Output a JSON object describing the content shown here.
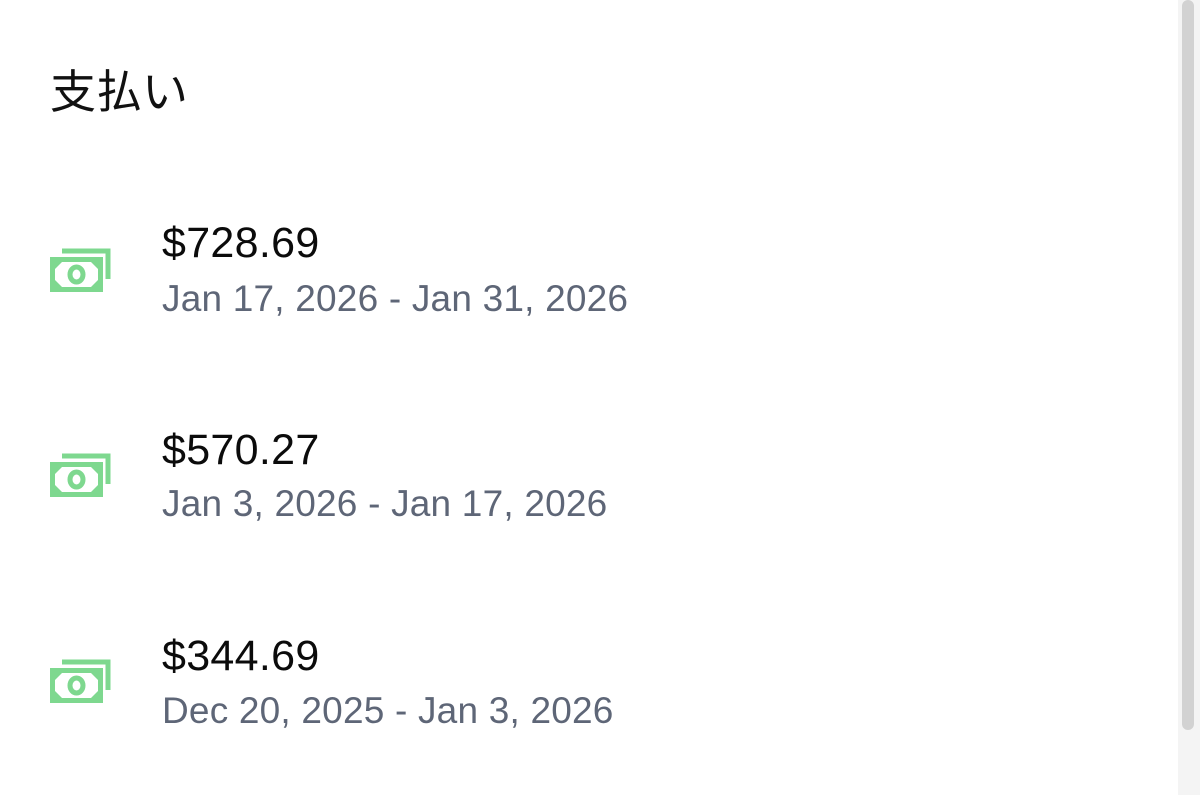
{
  "header": {
    "title": "支払い"
  },
  "accent_color": "#7ed88f",
  "payouts": [
    {
      "amount": "$728.69",
      "period": "Jan 17, 2026 - Jan 31, 2026",
      "icon": "cash-icon"
    },
    {
      "amount": "$570.27",
      "period": "Jan 3, 2026 - Jan 17, 2026",
      "icon": "cash-icon"
    },
    {
      "amount": "$344.69",
      "period": "Dec 20, 2025 - Jan 3, 2026",
      "icon": "cash-icon"
    }
  ]
}
